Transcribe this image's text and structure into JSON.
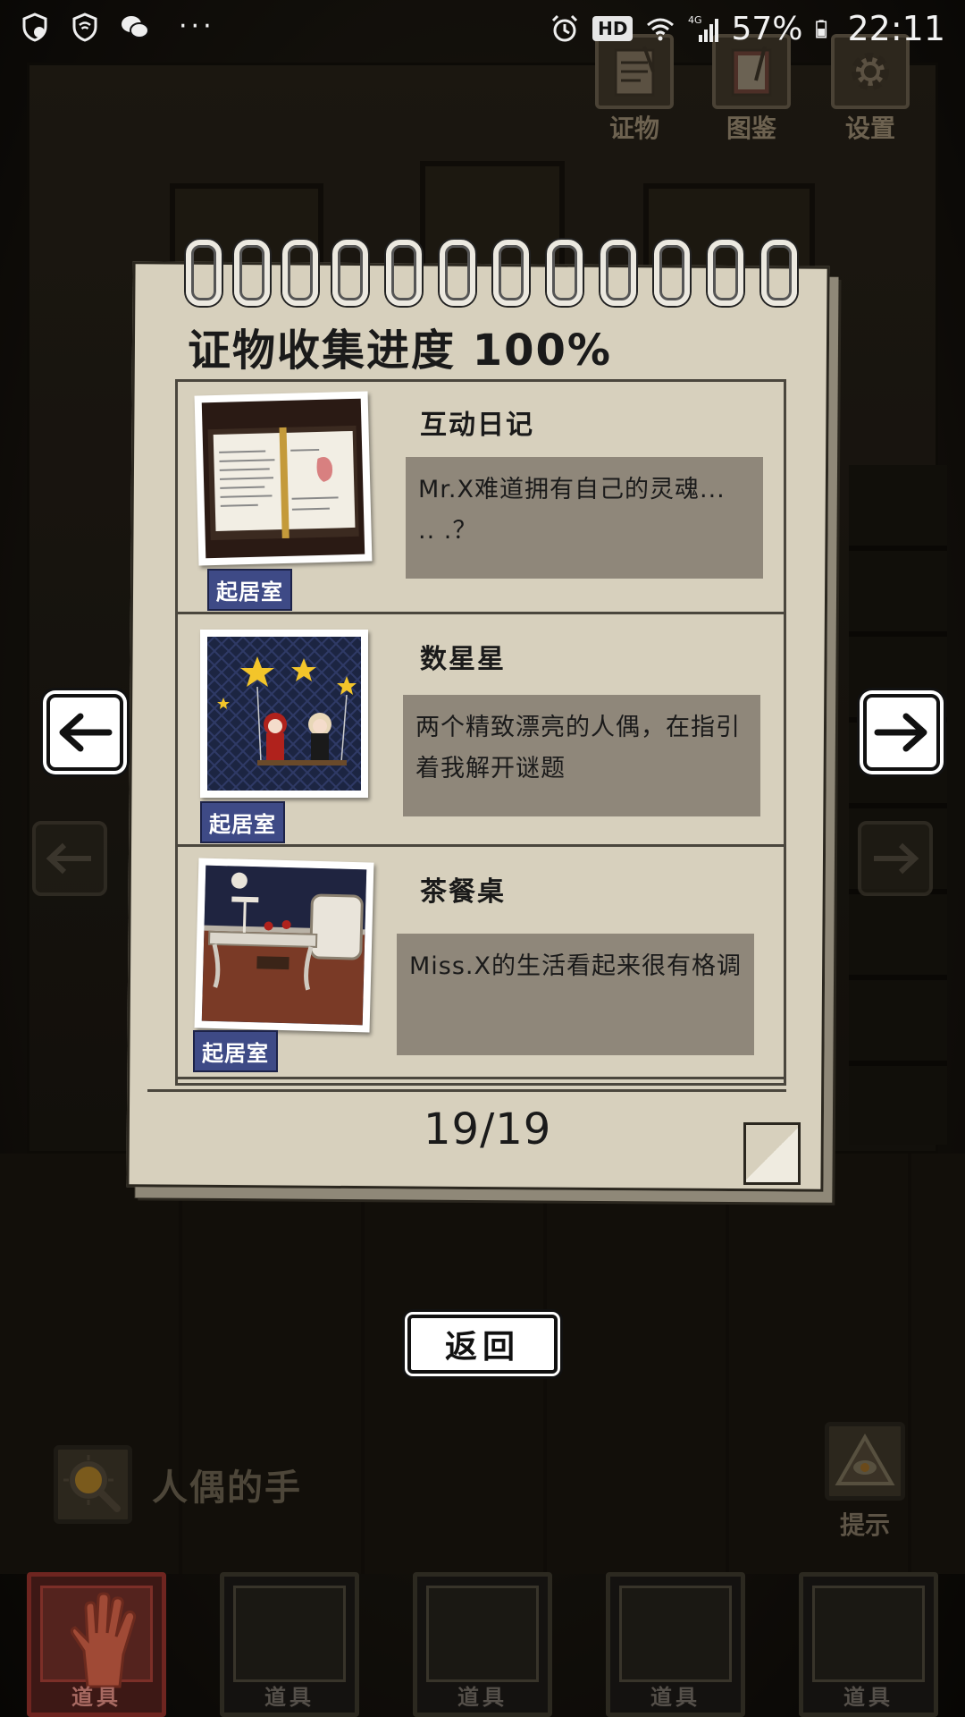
{
  "status_bar": {
    "battery_percent": "57%",
    "time": "22:11",
    "network": "4G",
    "hd_badge": "HD",
    "more_dots": "···"
  },
  "top_menu": [
    {
      "label": "证物",
      "icon": "clipboard-icon"
    },
    {
      "label": "图鉴",
      "icon": "notebook-icon"
    },
    {
      "label": "设置",
      "icon": "gear-icon"
    }
  ],
  "evidence_panel": {
    "title": "证物收集进度 100%",
    "progress_percent": 100,
    "entries": [
      {
        "name": "互动日记",
        "room": "起居室",
        "description": "Mr.X难道拥有自己的灵魂... .. .？",
        "thumbnail": "open-diary-image"
      },
      {
        "name": "数星星",
        "room": "起居室",
        "description": "两个精致漂亮的人偶，在指引着我解开谜题",
        "thumbnail": "dolls-on-swing-with-stars-image"
      },
      {
        "name": "茶餐桌",
        "room": "起居室",
        "description": "Miss.X的生活看起来很有格调",
        "thumbnail": "tea-table-room-image"
      }
    ],
    "page_counter": "19/19",
    "collected": 19,
    "total": 19
  },
  "back_button": {
    "label": "返回"
  },
  "clue_bar": {
    "text": "人偶的手",
    "icon": "magnifier-icon"
  },
  "hint_button": {
    "label": "提示",
    "icon": "all-seeing-eye-icon"
  },
  "inventory": [
    {
      "label": "道具",
      "selected": true,
      "item_icon": "doll-hand-icon"
    },
    {
      "label": "道具",
      "selected": false
    },
    {
      "label": "道具",
      "selected": false
    },
    {
      "label": "道具",
      "selected": false
    },
    {
      "label": "道具",
      "selected": false
    }
  ],
  "colors": {
    "room_tag": "#3e4a86",
    "paper": "#d7d0bd",
    "desc_box": "#8f877a",
    "selected_slot": "#3d1815"
  }
}
